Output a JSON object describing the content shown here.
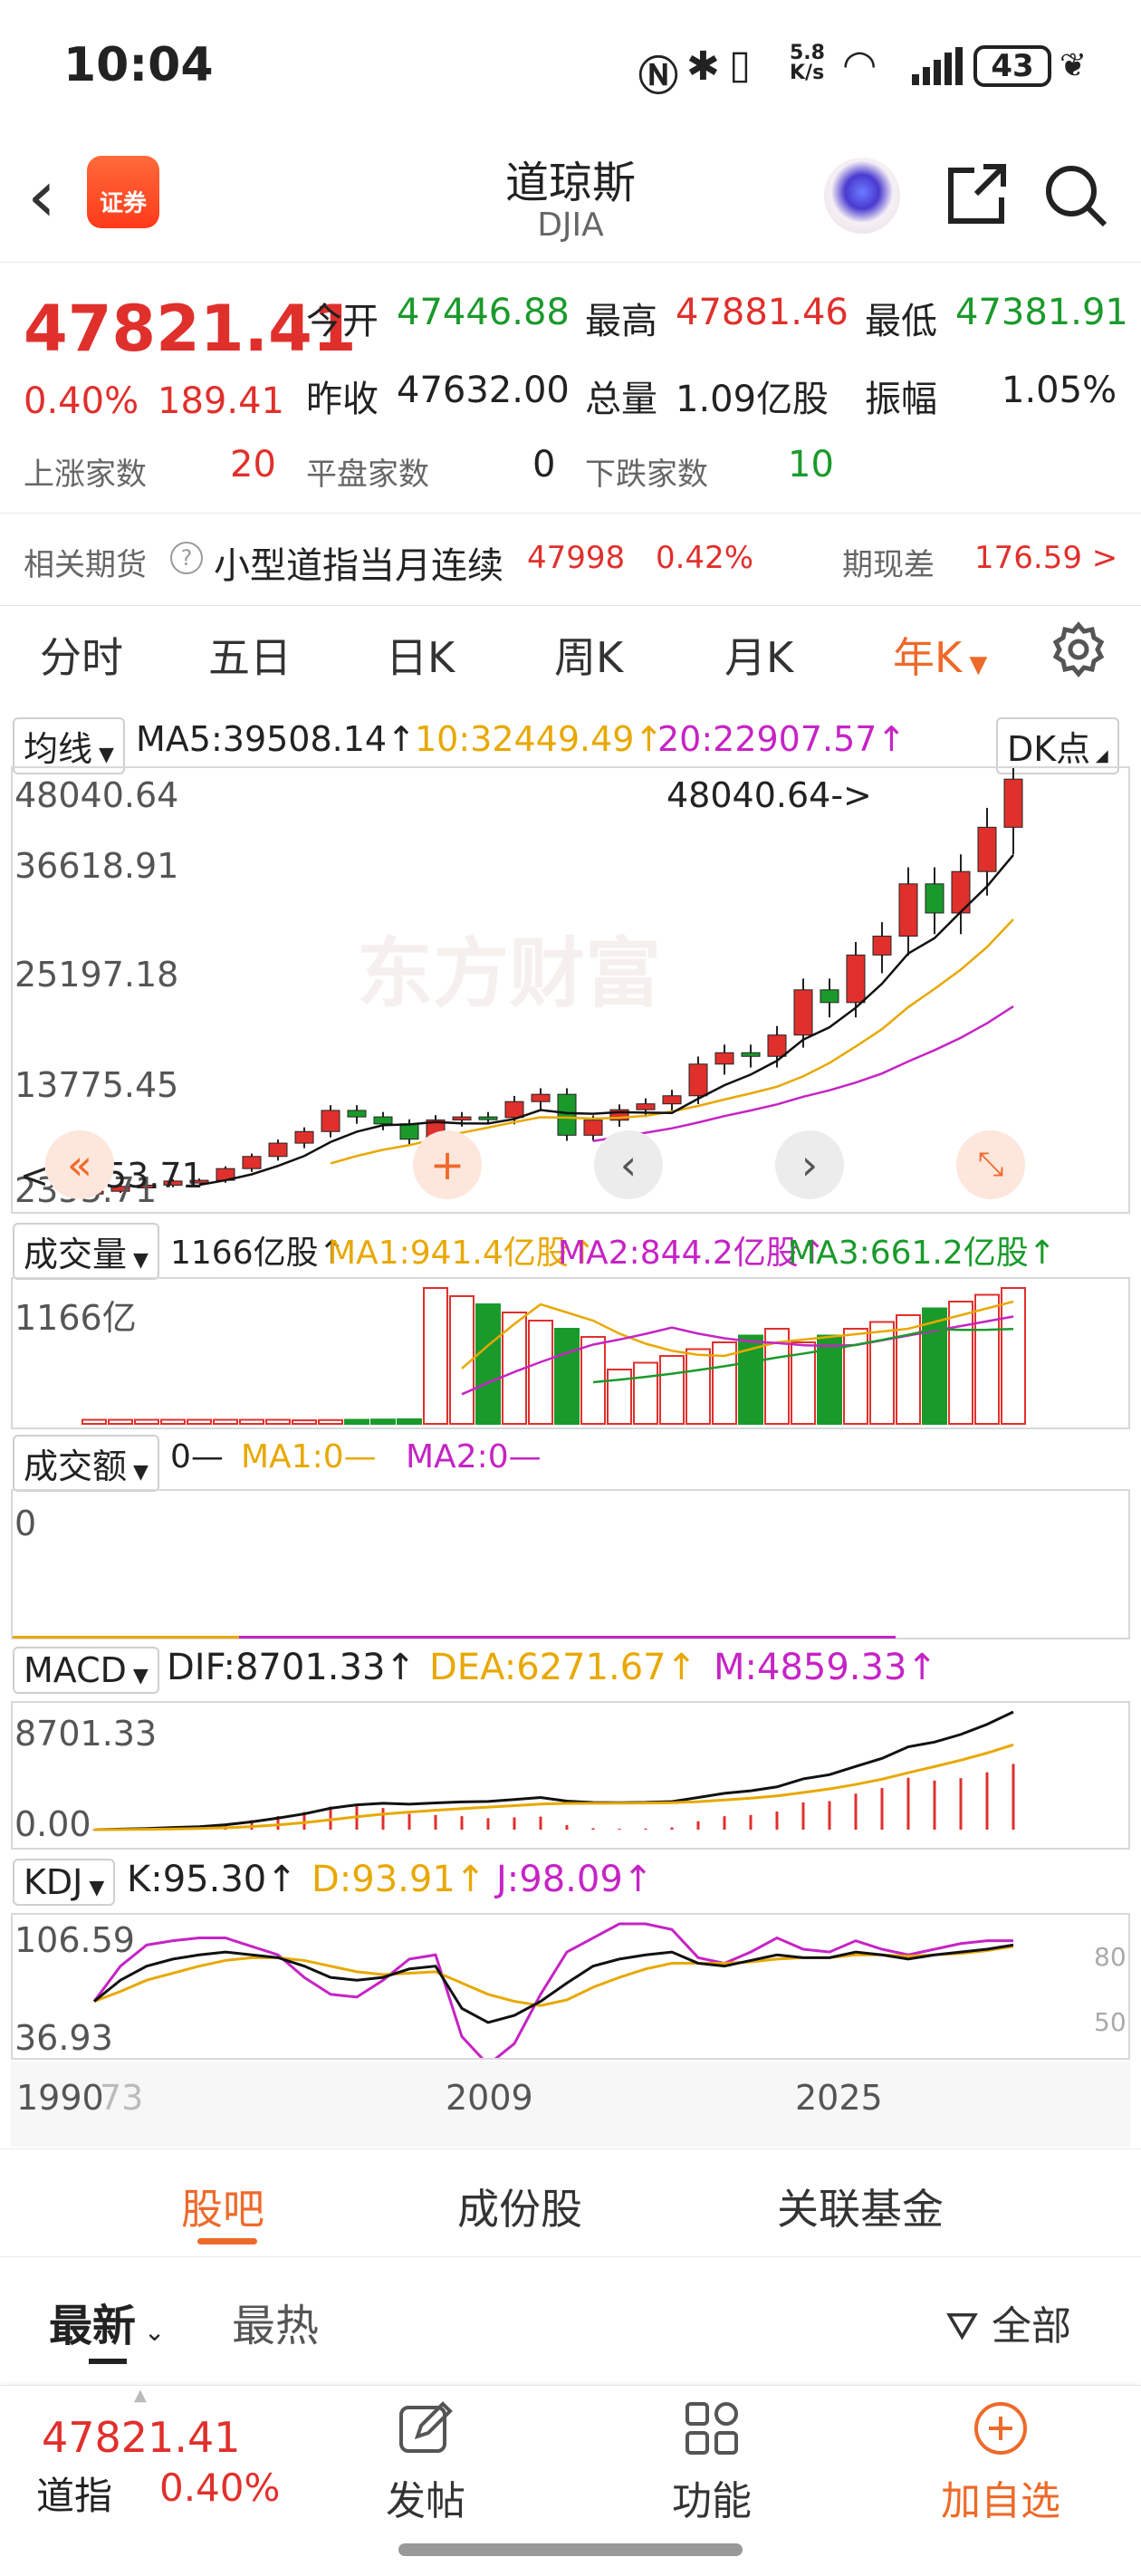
{
  "status": {
    "time": "10:04",
    "net_speed_top": "5.8",
    "net_speed_bottom": "K/s",
    "battery": "43"
  },
  "header": {
    "title": "道琼斯",
    "subtitle": "DJIA",
    "logo_text": "证券"
  },
  "quote": {
    "price": "47821.41",
    "pct": "0.40%",
    "change": "189.41",
    "open_label": "今开",
    "open": "47446.88",
    "high_label": "最高",
    "high": "47881.46",
    "low_label": "最低",
    "low": "47381.91",
    "prev_label": "昨收",
    "prev": "47632.00",
    "vol_label": "总量",
    "vol": "1.09亿股",
    "amp_label": "振幅",
    "amp": "1.05%",
    "up_label": "上涨家数",
    "up": "20",
    "flat_label": "平盘家数",
    "flat": "0",
    "down_label": "下跌家数",
    "down": "10"
  },
  "futures": {
    "label": "相关期货",
    "name": "小型道指当月连续",
    "price": "47998",
    "pct": "0.42%",
    "basis_label": "期现差",
    "basis": "176.59 >"
  },
  "tabs": [
    "分时",
    "五日",
    "日K",
    "周K",
    "月K",
    "年K",
    "⚙"
  ],
  "active_tab": "年K",
  "main_chart": {
    "indicator": "均线",
    "ma5": "MA5:39508.14↑",
    "ma10": "10:32449.49↑",
    "ma20": "20:22907.57↑",
    "dk_btn": "DK点",
    "yticks": [
      "48040.64",
      "36618.91",
      "25197.18",
      "13775.45",
      "2353.71"
    ],
    "high_label": "48040.64->",
    "low_label": "<-2353.71"
  },
  "vol_chart": {
    "indicator": "成交量",
    "value": "1166亿股↑",
    "ma1": "MA1:941.4亿股↑",
    "ma2": "MA2:844.2亿股↑",
    "ma3": "MA3:661.2亿股↑",
    "ytick": "1166亿"
  },
  "amt_chart": {
    "indicator": "成交额",
    "value": "0—",
    "ma1": "MA1:0—",
    "ma2": "MA2:0—",
    "ytick": "0"
  },
  "macd_chart": {
    "indicator": "MACD",
    "dif": "DIF:8701.33↑",
    "dea": "DEA:6271.67↑",
    "m": "M:4859.33↑",
    "ytop": "8701.33",
    "ybot": "0.00"
  },
  "kdj_chart": {
    "indicator": "KDJ",
    "k": "K:95.30↑",
    "d": "D:93.91↑",
    "j": "J:98.09↑",
    "ytop": "106.59",
    "ybot": "36.93",
    "r80": "80",
    "r50": "50"
  },
  "xaxis": [
    "1990",
    "73",
    "2009",
    "2025"
  ],
  "bottom_tabs": [
    "股吧",
    "成份股",
    "关联基金"
  ],
  "feed": {
    "latest": "最新",
    "hot": "最热",
    "filter": "全部"
  },
  "bottom_bar": {
    "price": "47821.41",
    "name": "道指",
    "pct": "0.40%",
    "post": "发帖",
    "func": "功能",
    "add": "加自选"
  },
  "chart_data": {
    "type": "candlestick",
    "period": "yearly",
    "note_values": "approx annual close DJIA",
    "closes": [
      2633,
      3169,
      3301,
      3754,
      3834,
      5117,
      6448,
      7908,
      9181,
      11497,
      10787,
      10021,
      8341,
      10453,
      10783,
      10717,
      12463,
      13264,
      8776,
      10428,
      11577,
      12217,
      13104,
      16576,
      17823,
      17425,
      19762,
      24719,
      23327,
      28538,
      30606,
      36338,
      33147,
      37689,
      42544,
      47821
    ]
  }
}
